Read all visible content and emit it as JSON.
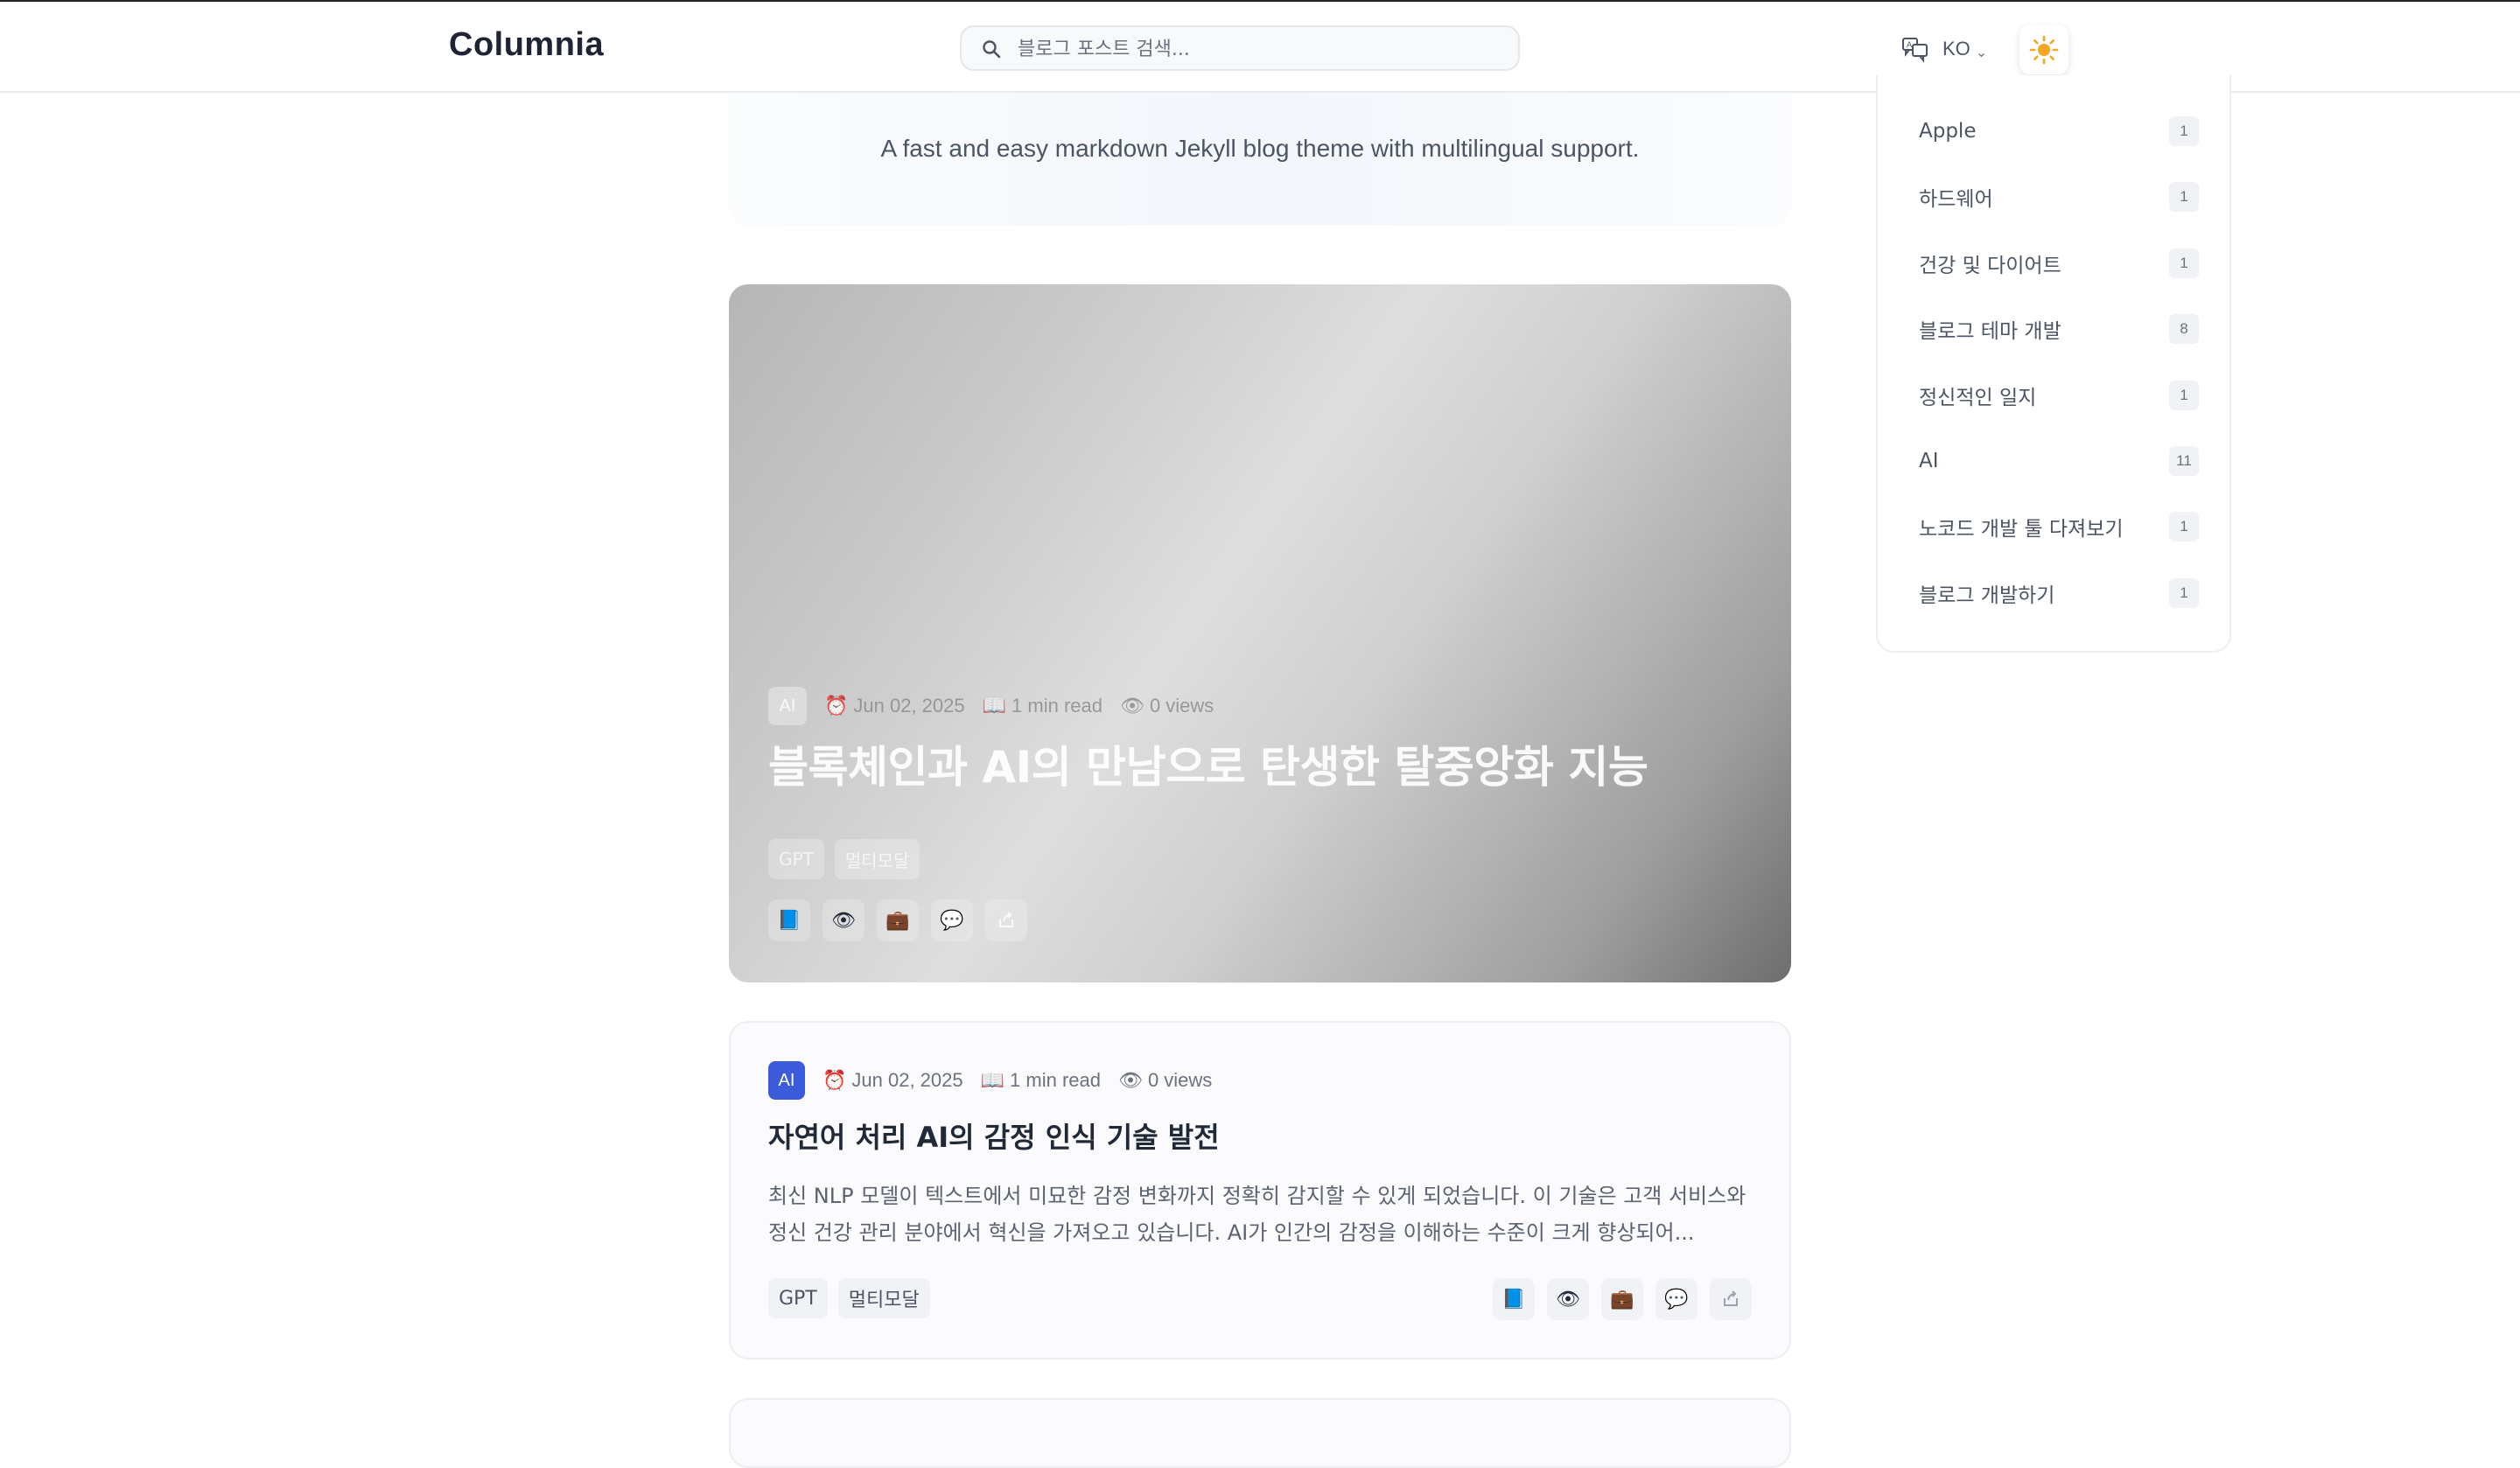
{
  "header": {
    "logo": "Columnia",
    "search_placeholder": "블로그 포스트 검색...",
    "language": "KO",
    "icons": {
      "search": "search-icon",
      "language": "translate-icon",
      "theme": "sun-icon"
    }
  },
  "hero": {
    "tagline": "A fast and easy markdown Jekyll blog theme with multilingual support."
  },
  "featured_post": {
    "category": "AI",
    "date": "Jun 02, 2025",
    "read_time": "1 min read",
    "views": "0 views",
    "title": "블록체인과 AI의 만남으로 탄생한 탈중앙화 지능",
    "tags": [
      "GPT",
      "멀티모달"
    ]
  },
  "post": {
    "category": "AI",
    "date": "Jun 02, 2025",
    "read_time": "1 min read",
    "views": "0 views",
    "title": "자연어 처리 AI의 감정 인식 기술 발전",
    "excerpt": "최신 NLP 모델이 텍스트에서 미묘한 감정 변화까지 정확히 감지할 수 있게 되었습니다. 이 기술은 고객 서비스와 정신 건강 관리 분야에서 혁신을 가져오고 있습니다. AI가 인간의 감정을 이해하는 수준이 크게 향상되어...",
    "tags": [
      "GPT",
      "멀티모달"
    ]
  },
  "action_icons": [
    "book-icon",
    "eye-icon",
    "briefcase-icon",
    "comment-icon",
    "share-icon"
  ],
  "sidebar": {
    "categories": [
      {
        "name": "Apple",
        "count": "1"
      },
      {
        "name": "하드웨어",
        "count": "1"
      },
      {
        "name": "건강 및 다이어트",
        "count": "1"
      },
      {
        "name": "블로그 테마 개발",
        "count": "8"
      },
      {
        "name": "정신적인 일지",
        "count": "1"
      },
      {
        "name": "AI",
        "count": "11"
      },
      {
        "name": "노코드 개발 툴 다져보기",
        "count": "1"
      },
      {
        "name": "블로그 개발하기",
        "count": "1"
      }
    ]
  },
  "colors": {
    "accent": "#3b5bdb",
    "sun": "#f5a623",
    "text": "#1f2937",
    "muted": "#6b7280"
  }
}
